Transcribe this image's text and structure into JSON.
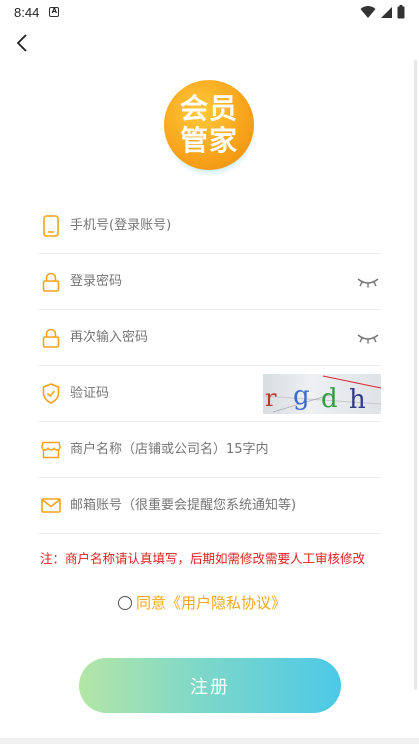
{
  "status_bar": {
    "time": "8:44",
    "notification_icon": "a-letter-icon",
    "right_icons": [
      "wifi-icon",
      "signal-icon",
      "battery-icon"
    ]
  },
  "header": {
    "back_icon": "chevron-left-icon"
  },
  "logo": {
    "text": "会员管家",
    "colors": {
      "gradient_start": "#ffc93a",
      "gradient_end": "#ec8c0c",
      "glow": "#78d2f0"
    }
  },
  "form": {
    "phone": {
      "placeholder": "手机号(登录账号)",
      "icon": "phone-icon"
    },
    "password": {
      "placeholder": "登录密码",
      "icon": "lock-icon",
      "toggle_icon": "eye-closed-icon"
    },
    "password_confirm": {
      "placeholder": "再次输入密码",
      "icon": "lock-icon",
      "toggle_icon": "eye-closed-icon"
    },
    "captcha": {
      "placeholder": "验证码",
      "icon": "shield-check-icon",
      "image_text": "rgdh"
    },
    "shop_name": {
      "placeholder": "商户名称（店铺或公司名）15字内",
      "icon": "store-icon"
    },
    "email": {
      "placeholder": "邮箱账号（很重要会提醒您系统通知等)",
      "icon": "mail-icon"
    }
  },
  "notice": "注：商户名称请认真填写，后期如需修改需要人工审核修改",
  "agreement": {
    "checked": false,
    "prefix": "同意",
    "link": "《用户隐私协议》"
  },
  "register_button": "注册",
  "colors": {
    "accent_orange": "#f2a81c",
    "notice_red": "#e02020",
    "icon_orange": "#f7a21a",
    "button_gradient_start": "#b4e6a6",
    "button_gradient_end": "#4cc9e8"
  }
}
